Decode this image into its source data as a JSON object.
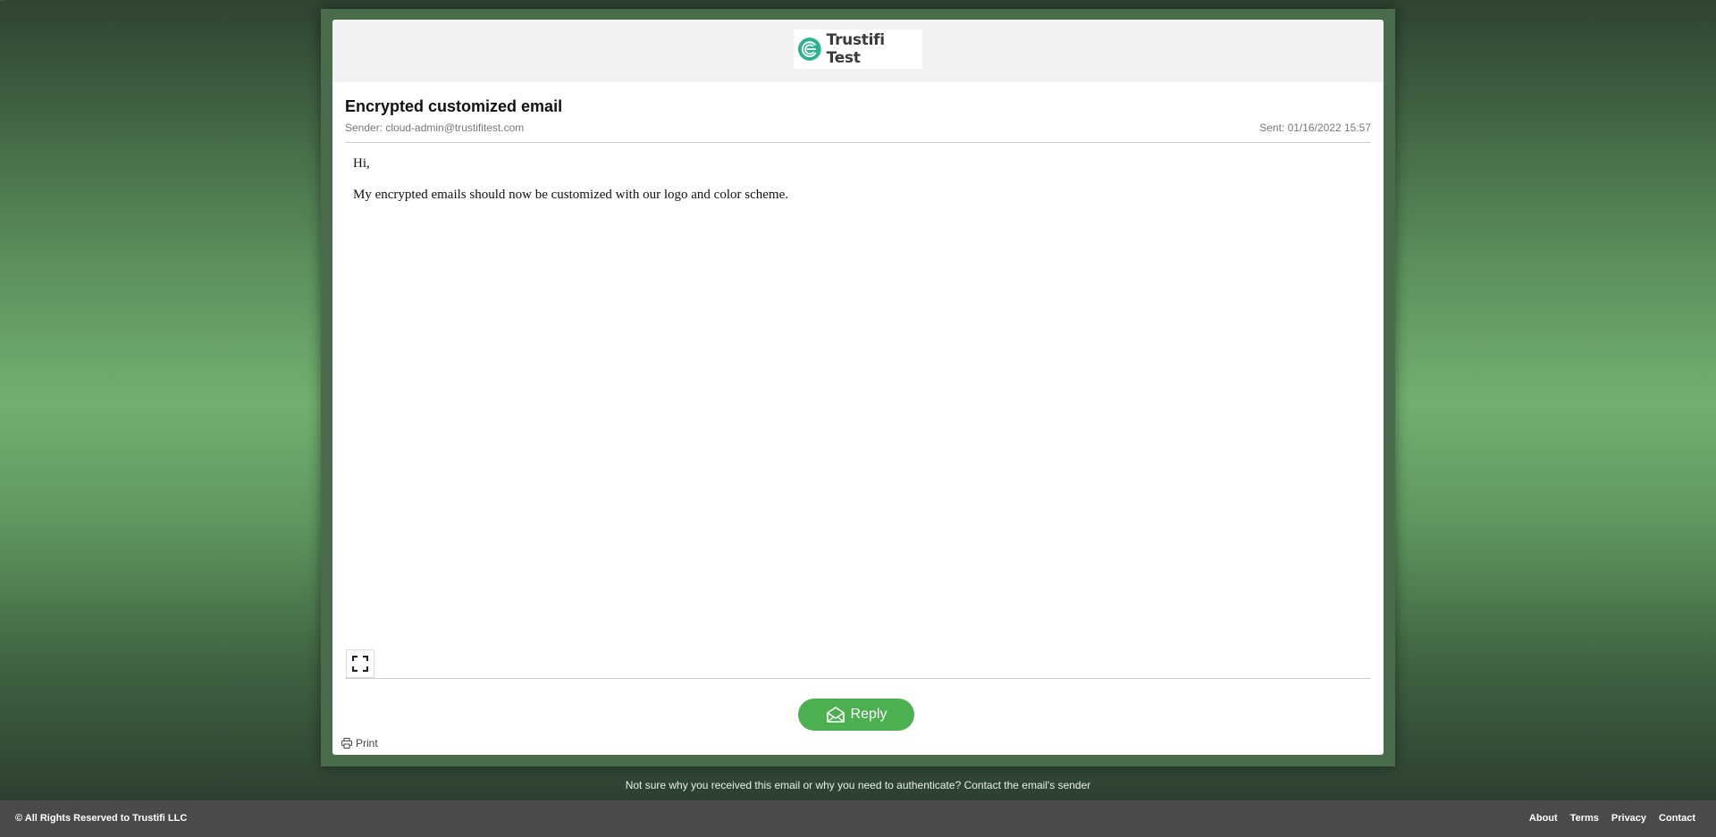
{
  "page": {
    "corner_mark": "\""
  },
  "brand": {
    "logo_text": "Trustifi Test",
    "accent_color": "#4caf50",
    "logo_color": "#2bb38f",
    "icon": "trustifi-logo-icon"
  },
  "email": {
    "subject": "Encrypted customized email",
    "sender": "Sender: cloud-admin@trustifitest.com",
    "sent": "Sent: 01/16/2022 15:57",
    "body": {
      "greeting": "Hi,",
      "message": "My encrypted emails should now be customized with our logo and color scheme."
    }
  },
  "actions": {
    "fullscreen_icon": "expand-icon",
    "reply_label": "Reply",
    "reply_icon": "envelope-icon",
    "print_label": "Print",
    "print_icon": "printer-icon"
  },
  "help": {
    "text": "Not sure why you received this email or why you need to authenticate? Contact the email's sender"
  },
  "footer": {
    "copyright": "© All Rights Reserved to Trustifi LLC",
    "links": [
      "About",
      "Terms",
      "Privacy",
      "Contact"
    ],
    "background_color": "#4a4a4a"
  }
}
